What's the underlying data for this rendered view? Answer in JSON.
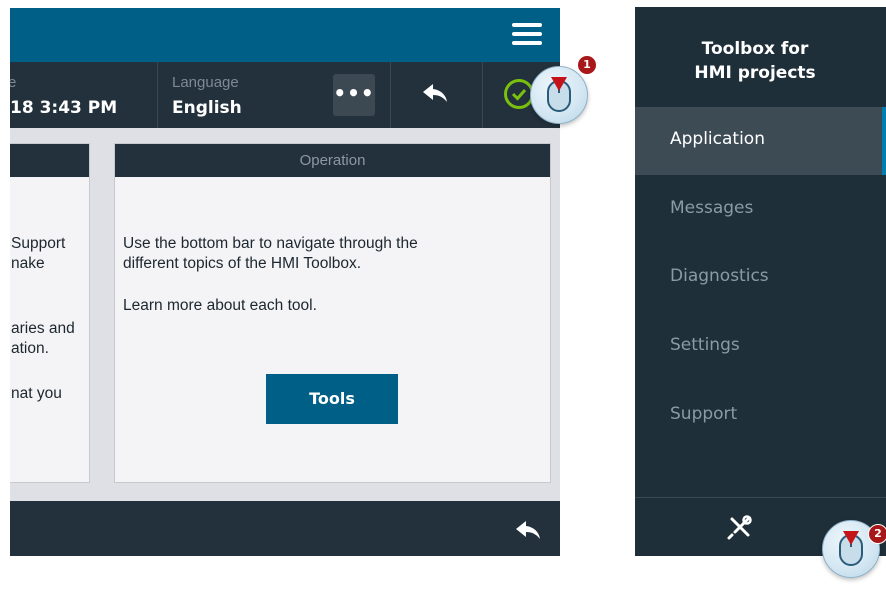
{
  "left_screen": {
    "info_bar": {
      "date_label": "e",
      "date_value": "18 3:43 PM",
      "language_label": "Language",
      "language_value": "English",
      "more_label": "•••"
    },
    "left_panel": {
      "lines": [
        "Support",
        "nake",
        "aries and",
        "ation.",
        "nat you"
      ]
    },
    "operation_panel": {
      "title": "Operation",
      "line1": "Use the bottom bar to navigate through the",
      "line2": "different topics of the HMI Toolbox.",
      "line3": "Learn more about each tool.",
      "tools_button": "Tools"
    },
    "callout_1": "1",
    "colors": {
      "primary": "#005f87",
      "dark": "#23313c",
      "ok": "#7ac10d"
    }
  },
  "sidebar": {
    "title_line1": "Toolbox for",
    "title_line2": "HMI projects",
    "items": [
      {
        "label": "Application",
        "active": true
      },
      {
        "label": "Messages",
        "active": false
      },
      {
        "label": "Diagnostics",
        "active": false
      },
      {
        "label": "Settings",
        "active": false
      },
      {
        "label": "Support",
        "active": false
      }
    ],
    "tools_icon": "tools-icon",
    "callout_2": "2"
  }
}
